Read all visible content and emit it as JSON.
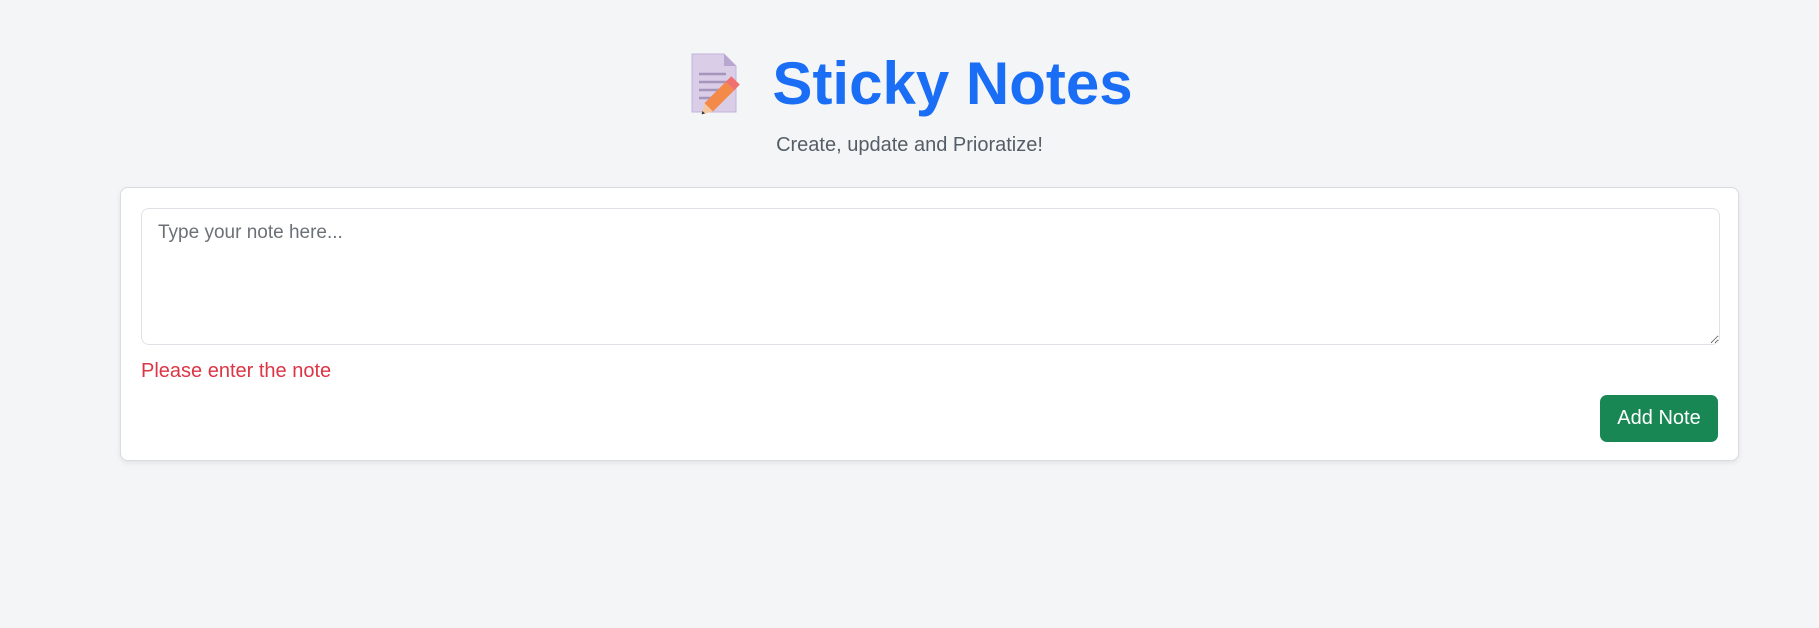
{
  "header": {
    "icon": "memo-pencil-icon",
    "title": "Sticky Notes",
    "subtitle": "Create, update and Prioratize!"
  },
  "form": {
    "note_placeholder": "Type your note here...",
    "note_value": "",
    "error_message": "Please enter the note",
    "add_button_label": "Add Note"
  },
  "colors": {
    "background": "#f4f5f7",
    "title": "#1a6ef5",
    "error": "#dc3545",
    "primary_button": "#198754"
  }
}
